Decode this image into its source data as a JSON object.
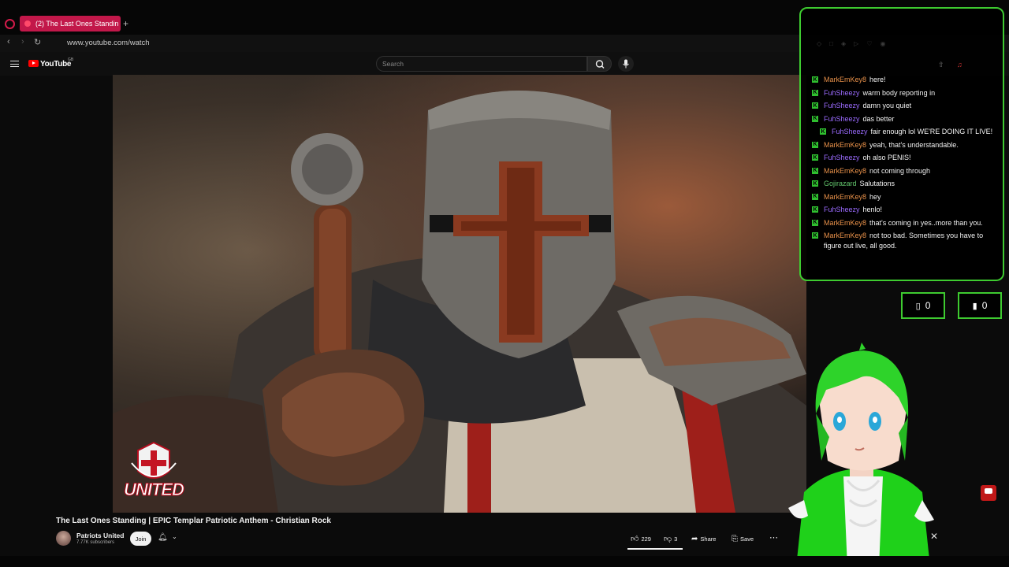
{
  "browser": {
    "tab_title": "(2) The Last Ones Standin",
    "url": "www.youtube.com/watch"
  },
  "youtube": {
    "logo_text": "YouTube",
    "region": "GB",
    "search_placeholder": "Search"
  },
  "video": {
    "title": "The Last Ones Standing | EPIC Templar Patriotic Anthem - Christian Rock",
    "watermark_text": "UNITED",
    "channel": {
      "name": "Patriots United",
      "subscribers": "7.77K subscribers",
      "join_label": "Join"
    },
    "actions": {
      "likes": "229",
      "dislikes": "3",
      "share_label": "Share",
      "save_label": "Save"
    }
  },
  "chat": {
    "messages": [
      {
        "user": "MarkEmKey8",
        "color": "orange",
        "text": "here!",
        "indent": false
      },
      {
        "user": "FuhSheezy",
        "color": "purple",
        "text": "warm body reporting in",
        "indent": false
      },
      {
        "user": "FuhSheezy",
        "color": "purple",
        "text": "damn you quiet",
        "indent": false
      },
      {
        "user": "FuhSheezy",
        "color": "purple",
        "text": "das better",
        "indent": false
      },
      {
        "user": "FuhSheezy",
        "color": "purple",
        "text": "fair enough lol WE'RE DOING IT LIVE!",
        "indent": true
      },
      {
        "user": "MarkEmKey8",
        "color": "orange",
        "text": "yeah, that's understandable.",
        "indent": false
      },
      {
        "user": "FuhSheezy",
        "color": "purple",
        "text": "oh also PENIS!",
        "indent": false
      },
      {
        "user": "MarkEmKey8",
        "color": "orange",
        "text": "not coming through",
        "indent": false
      },
      {
        "user": "Gojirazard",
        "color": "green",
        "text": "Salutations",
        "indent": false
      },
      {
        "user": "MarkEmKey8",
        "color": "orange",
        "text": "hey",
        "indent": false
      },
      {
        "user": "FuhSheezy",
        "color": "purple",
        "text": "henlo!",
        "indent": false
      },
      {
        "user": "MarkEmKey8",
        "color": "orange",
        "text": "that's coming in yes..more than you.",
        "indent": false
      },
      {
        "user": "MarkEmKey8",
        "color": "orange",
        "text": "not too bad. Sometimes you have to figure out live, all good.",
        "indent": false
      }
    ]
  },
  "counters": [
    {
      "icon": "outline-square-icon",
      "value": "0"
    },
    {
      "icon": "filled-square-icon",
      "value": "0"
    }
  ],
  "colors": {
    "accent_green": "#3ecb30",
    "tab_pink": "#c2184a",
    "youtube_red": "#ff0000"
  }
}
